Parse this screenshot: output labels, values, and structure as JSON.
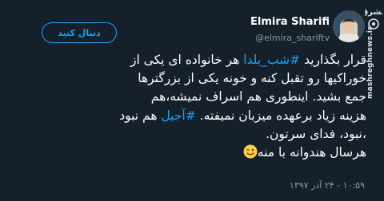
{
  "tweet": {
    "follow_label": "دنبال کنید",
    "display_name": "Elmira Sharifi",
    "handle": "@elmira_shariftv",
    "watermark_text": "mashreghnews.ir",
    "body": {
      "line1": {
        "before": "قرار بگذارید ",
        "hashtag": "#شب_یلدا",
        "after": " هر خانواده ای یکی از"
      },
      "line2": "خوراکیها رو تقبل کنه و خونه یکی از بزرگترها",
      "line3": "جمع بشید. اینطوری هم اسراف نمیشه،هم",
      "line4": {
        "before": "هزینه زیاد برعهده میزبان نمیفته. ",
        "hashtag": "#آجیل",
        "after": " هم نبود"
      },
      "line5": "،نبود، فدای سرتون.",
      "line6": "هرسال هندوانه با منه"
    },
    "emoji": "winking-face-emoji",
    "timestamp": "۱۰:۵۹ - ۲۴ آذر ۱۳۹۷"
  },
  "colors": {
    "background": "#15202b",
    "accent": "#1da1f2",
    "secondary_text": "#8899a6"
  }
}
